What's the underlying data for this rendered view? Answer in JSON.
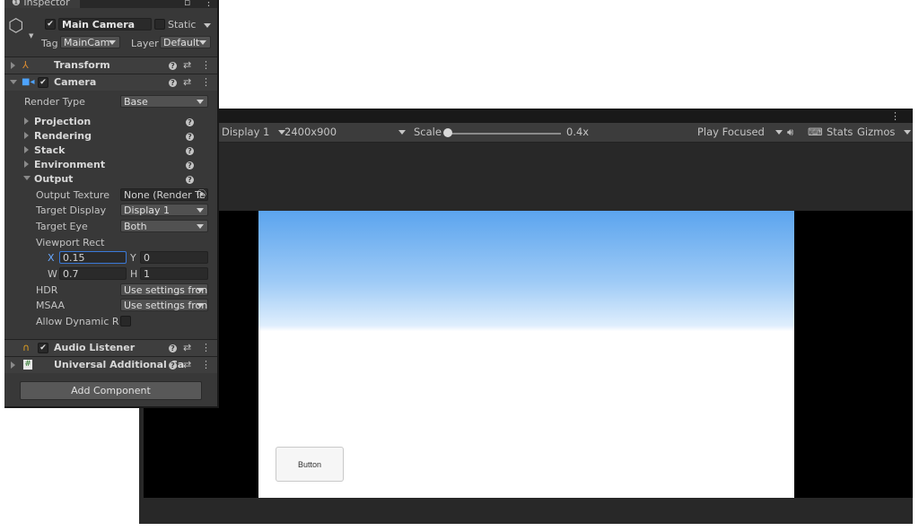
{
  "inspector": {
    "tab_label": "Inspector",
    "gameobject": {
      "active": true,
      "name": "Main Camera",
      "static_label": "Static",
      "tag_label": "Tag",
      "tag_value": "MainCam ",
      "layer_label": "Layer",
      "layer_value": "Default"
    },
    "components": {
      "transform": "Transform",
      "camera": "Camera",
      "audio_listener": "Audio Listener",
      "universal_additional": "Universal Additional Ca"
    },
    "camera": {
      "render_type_label": "Render Type",
      "render_type_value": "Base",
      "sections": [
        "Projection",
        "Rendering",
        "Stack",
        "Environment",
        "Output"
      ],
      "output": {
        "output_texture_label": "Output Texture",
        "output_texture_value": "None (Render Te",
        "target_display_label": "Target Display",
        "target_display_value": "Display 1",
        "target_eye_label": "Target Eye",
        "target_eye_value": "Both",
        "viewport_rect_label": "Viewport Rect",
        "x_label": "X",
        "x_value": "0.15",
        "y_label": "Y",
        "y_value": "0",
        "w_label": "W",
        "w_value": "0.7",
        "h_label": "H",
        "h_value": "1",
        "hdr_label": "HDR",
        "hdr_value": "Use settings fron",
        "msaa_label": "MSAA",
        "msaa_value": "Use settings fron",
        "allow_dynamic_label": "Allow Dynamic Res"
      }
    },
    "add_component_label": "Add Component"
  },
  "game_view": {
    "display": "Display 1",
    "resolution": "2400x900",
    "scale_label": "Scale",
    "scale_value": "0.4x",
    "play_mode": "Play Focused",
    "stats": "Stats",
    "gizmos": "Gizmos",
    "canvas_button_label": "Button"
  },
  "colors": {
    "sky_top": "#5ba4ee",
    "editor_dark": "#282828",
    "panel": "#383838"
  }
}
